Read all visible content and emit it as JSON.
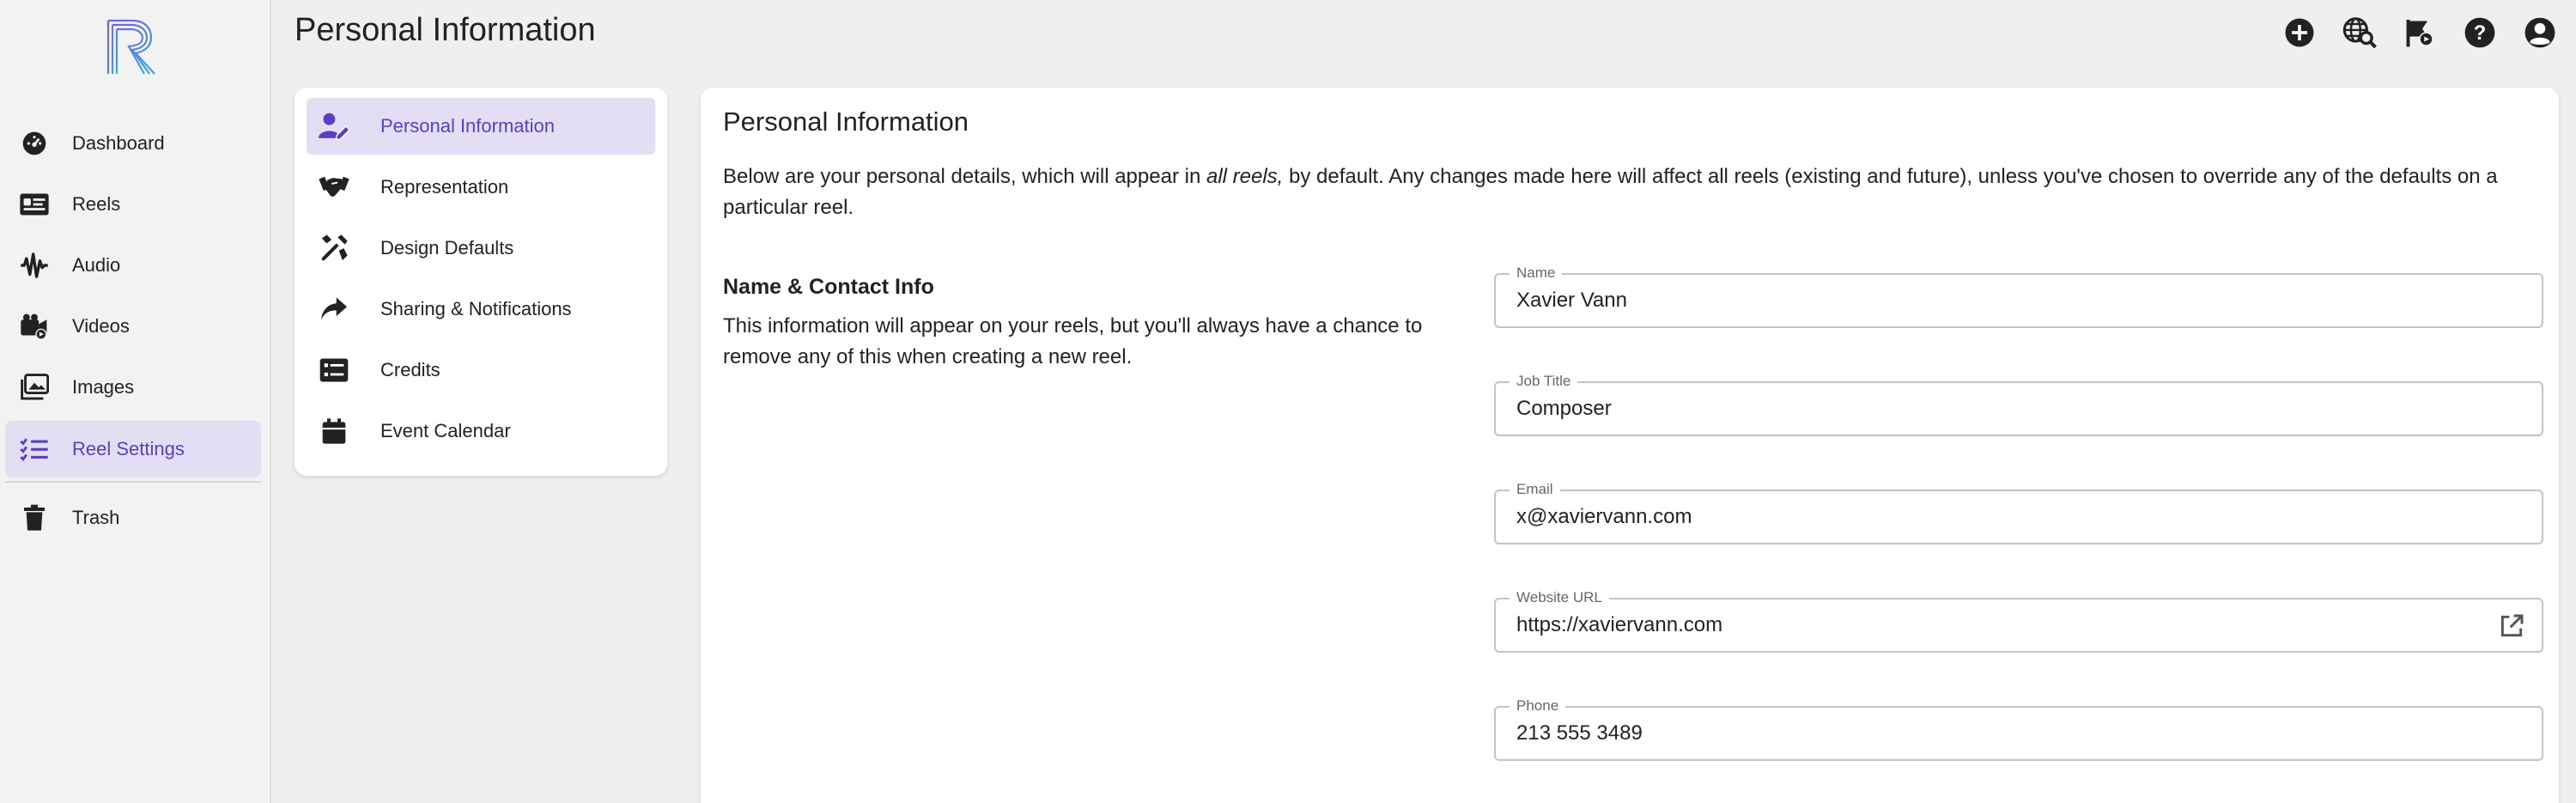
{
  "app": {
    "page_title": "Personal Information"
  },
  "sidebar": {
    "items": [
      {
        "label": "Dashboard",
        "icon": "dashboard-gauge-icon"
      },
      {
        "label": "Reels",
        "icon": "reels-card-icon"
      },
      {
        "label": "Audio",
        "icon": "audio-waveform-icon"
      },
      {
        "label": "Videos",
        "icon": "video-camera-icon"
      },
      {
        "label": "Images",
        "icon": "images-gallery-icon"
      },
      {
        "label": "Reel Settings",
        "icon": "settings-list-icon",
        "active": true
      },
      {
        "label": "Trash",
        "icon": "trash-icon"
      }
    ]
  },
  "top_bar": {
    "icons": [
      "add-circle-icon",
      "globe-search-icon",
      "flag-play-icon",
      "help-circle-icon",
      "account-circle-icon"
    ]
  },
  "submenu": {
    "items": [
      {
        "label": "Personal Information",
        "icon": "user-edit-icon",
        "active": true
      },
      {
        "label": "Representation",
        "icon": "handshake-icon"
      },
      {
        "label": "Design Defaults",
        "icon": "design-tools-icon"
      },
      {
        "label": "Sharing & Notifications",
        "icon": "share-arrow-icon"
      },
      {
        "label": "Credits",
        "icon": "credits-list-icon"
      },
      {
        "label": "Event Calendar",
        "icon": "calendar-icon"
      }
    ]
  },
  "main": {
    "title": "Personal Information",
    "intro_before": "Below are your personal details, which will appear in ",
    "intro_emphasis": "all reels,",
    "intro_after": " by default. Any changes made here will affect all reels (existing and future), unless you've chosen to override any of the defaults on a particular reel.",
    "section_heading": "Name & Contact Info",
    "section_description": "This information will appear on your reels, but you'll always have a chance to remove any of this when creating a new reel.",
    "fields": [
      {
        "label": "Name",
        "value": "Xavier Vann"
      },
      {
        "label": "Job Title",
        "value": "Composer"
      },
      {
        "label": "Email",
        "value": "x@xaviervann.com"
      },
      {
        "label": "Website URL",
        "value": "https://xaviervann.com",
        "action_icon": "open-external-icon"
      },
      {
        "label": "Phone",
        "value": "213 555 3489"
      }
    ]
  },
  "colors": {
    "accent": "#5a3fc0",
    "active_background": "#e4def4",
    "page_background": "#efefef",
    "card_background": "#ffffff"
  }
}
